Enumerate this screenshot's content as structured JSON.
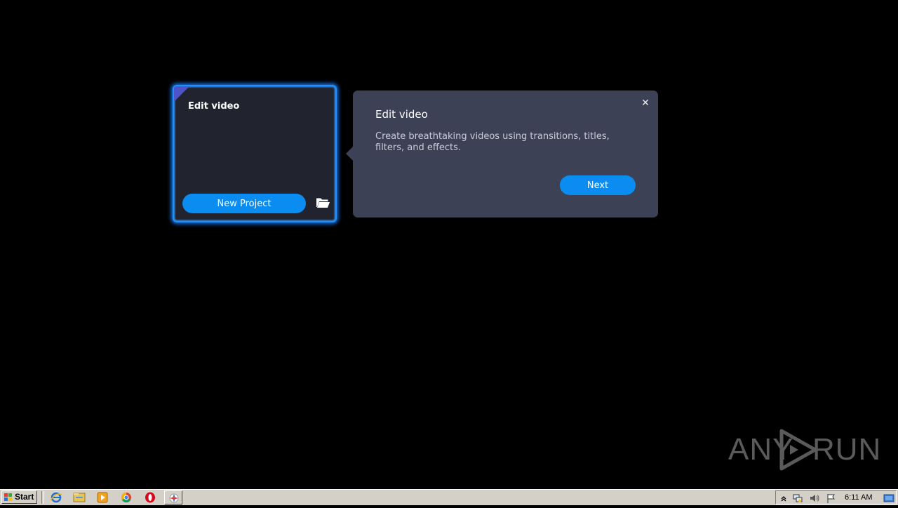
{
  "card": {
    "title": "Edit video",
    "new_project_label": "New Project",
    "open_icon": "folder-open-icon"
  },
  "popup": {
    "title": "Edit video",
    "description": "Create breathtaking videos using transitions, titles, filters, and effects.",
    "close_symbol": "✕",
    "next_label": "Next"
  },
  "watermark": {
    "left_text": "ANY",
    "right_text": "RUN"
  },
  "taskbar": {
    "start_label": "Start",
    "clock": "6:11 AM",
    "pinned": [
      "internet-explorer-icon",
      "file-explorer-icon",
      "media-player-icon",
      "chrome-icon",
      "opera-icon",
      "app-icon"
    ],
    "tray": [
      "show-hidden-icons-icon",
      "network-icon",
      "volume-icon",
      "action-center-flag-icon",
      "show-desktop-icon"
    ]
  },
  "colors": {
    "accent": "#0a8cf0",
    "card_border": "#1e90ff",
    "popup_bg": "#3d4155",
    "card_bg": "#21232f"
  }
}
